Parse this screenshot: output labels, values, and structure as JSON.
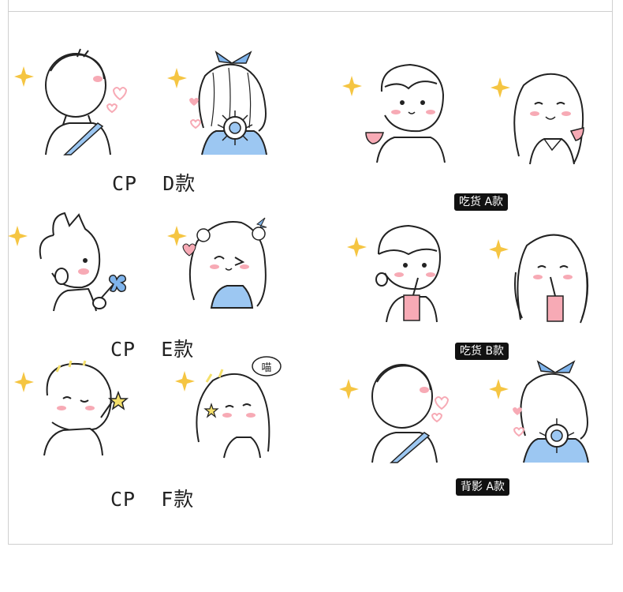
{
  "labels": {
    "cp_d": "CP  D款",
    "cp_e": "CP  E款",
    "cp_f": "CP  F款",
    "chihuo_a": "吃货 A款",
    "chihuo_b": "吃货 B款",
    "beiying_a": "背影 A款"
  },
  "bubble_text": "喵",
  "colors": {
    "sparkle": "#f5c542",
    "ribbon": "#7fb4ec",
    "blush": "#f7aab5",
    "shirt_blue": "#9cc7f2",
    "star_yellow": "#f5e06b",
    "line": "#222222"
  }
}
